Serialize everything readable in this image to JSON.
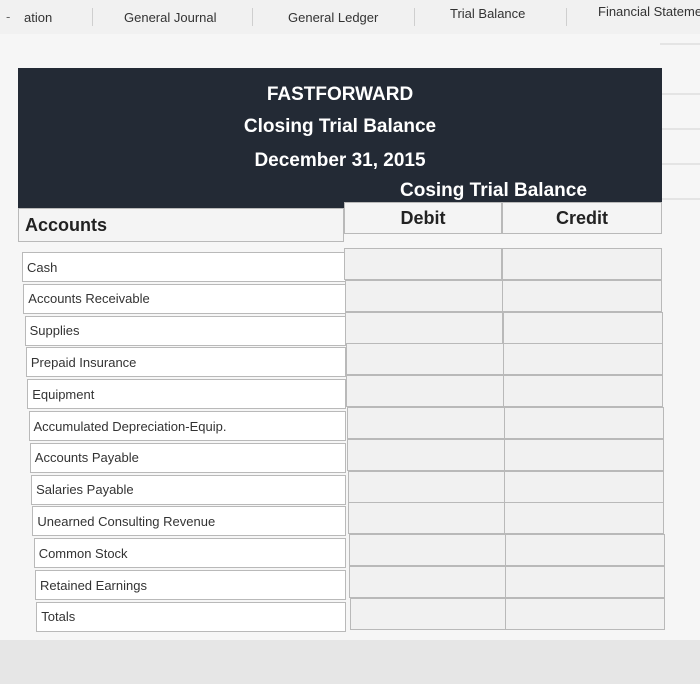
{
  "tabs": [
    {
      "label": "ation"
    },
    {
      "label": "General Journal"
    },
    {
      "label": "General Ledger"
    },
    {
      "label": "Trial Balance"
    },
    {
      "label": "Financial Stateme"
    }
  ],
  "header": {
    "company": "FASTFORWARD",
    "statement": "Closing Trial Balance",
    "date": "December 31, 2015",
    "group_label": "Cosing Trial Balance"
  },
  "table": {
    "accounts_header": "Accounts",
    "debit_header": "Debit",
    "credit_header": "Credit",
    "rows": [
      {
        "account": "Cash",
        "debit": "",
        "credit": ""
      },
      {
        "account": "Accounts Receivable",
        "debit": "",
        "credit": ""
      },
      {
        "account": "Supplies",
        "debit": "",
        "credit": ""
      },
      {
        "account": "Prepaid Insurance",
        "debit": "",
        "credit": ""
      },
      {
        "account": "Equipment",
        "debit": "",
        "credit": ""
      },
      {
        "account": "Accumulated Depreciation-Equip.",
        "debit": "",
        "credit": ""
      },
      {
        "account": "Accounts Payable",
        "debit": "",
        "credit": ""
      },
      {
        "account": "Salaries Payable",
        "debit": "",
        "credit": ""
      },
      {
        "account": "Unearned Consulting Revenue",
        "debit": "",
        "credit": ""
      },
      {
        "account": "Common Stock",
        "debit": "",
        "credit": ""
      },
      {
        "account": "Retained Earnings",
        "debit": "",
        "credit": ""
      },
      {
        "account": "Totals",
        "debit": "",
        "credit": ""
      }
    ]
  }
}
